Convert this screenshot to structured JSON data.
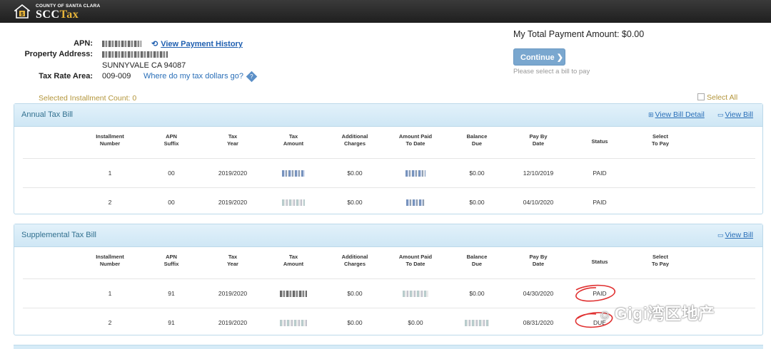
{
  "header": {
    "logo_small": "COUNTY OF SANTA CLARA",
    "logo_main": "SCC",
    "logo_tax": "Tax"
  },
  "property": {
    "apn_label": "APN:",
    "view_history": "View Payment History",
    "address_label": "Property Address:",
    "city_line": "SUNNYVALE CA 94087",
    "tax_rate_label": "Tax Rate Area:",
    "tax_rate_value": "009-009",
    "tax_dollars_link": "Where do my tax dollars go?"
  },
  "payment": {
    "total": "My Total Payment Amount: $0.00",
    "continue_label": "Continue",
    "please_select": "Please select a bill to pay"
  },
  "selection": {
    "count": "Selected Installment Count: 0",
    "select_all": "Select All"
  },
  "columns": [
    [
      "Installment",
      "Number"
    ],
    [
      "APN",
      "Suffix"
    ],
    [
      "Tax",
      "Year"
    ],
    [
      "Tax",
      "Amount"
    ],
    [
      "Additional",
      "Charges"
    ],
    [
      "Amount Paid",
      "To Date"
    ],
    [
      "Balance",
      "Due"
    ],
    [
      "Pay By",
      "Date"
    ],
    [
      "Status",
      ""
    ],
    [
      "Select",
      "To Pay"
    ]
  ],
  "annual": {
    "title": "Annual Tax Bill",
    "view_detail": "View Bill Detail",
    "view_bill": "View Bill",
    "rows": [
      {
        "num": "1",
        "suffix": "00",
        "year": "2019/2020",
        "charges": "$0.00",
        "balance": "$0.00",
        "paybydate": "12/10/2019",
        "status": "PAID"
      },
      {
        "num": "2",
        "suffix": "00",
        "year": "2019/2020",
        "charges": "$0.00",
        "balance": "$0.00",
        "paybydate": "04/10/2020",
        "status": "PAID"
      }
    ]
  },
  "supplemental": {
    "title": "Supplemental Tax Bill",
    "view_bill": "View Bill",
    "rows": [
      {
        "num": "1",
        "suffix": "91",
        "year": "2019/2020",
        "charges": "$0.00",
        "paid": "",
        "balance": "$0.00",
        "paybydate": "04/30/2020",
        "status": "PAID"
      },
      {
        "num": "2",
        "suffix": "91",
        "year": "2019/2020",
        "charges": "$0.00",
        "paid": "$0.00",
        "balance": "",
        "paybydate": "08/31/2020",
        "status": "DUE"
      }
    ]
  },
  "watermark": "Gigi湾区地产",
  "colors": {
    "accent": "#2a6fb8",
    "panel_head": "#d9edf7",
    "button": "#7aa7cf",
    "annotation": "#e03030"
  }
}
